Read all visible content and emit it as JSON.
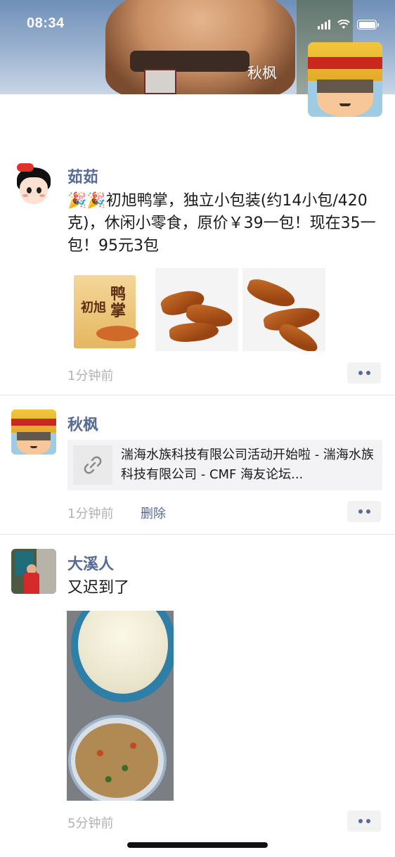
{
  "status_bar": {
    "time": "08:34"
  },
  "cover": {
    "name": "秋枫"
  },
  "posts": [
    {
      "name": "茹茹",
      "text": "🎉🎉初旭鸭掌，独立小包装(约14小包/420克)，休闲小零食，原价￥39一包！现在35一包！95元3包",
      "time": "1分钟前",
      "image_pack_text": {
        "brand": "初旭",
        "title": "鸭掌"
      }
    },
    {
      "name": "秋枫",
      "link_text": "湍海水族科技有限公司活动开始啦 - 湍海水族科技有限公司 - CMF 海友论坛...",
      "time": "1分钟前",
      "delete_label": "删除"
    },
    {
      "name": "大溪人",
      "text": "又迟到了",
      "time": "5分钟前"
    }
  ]
}
